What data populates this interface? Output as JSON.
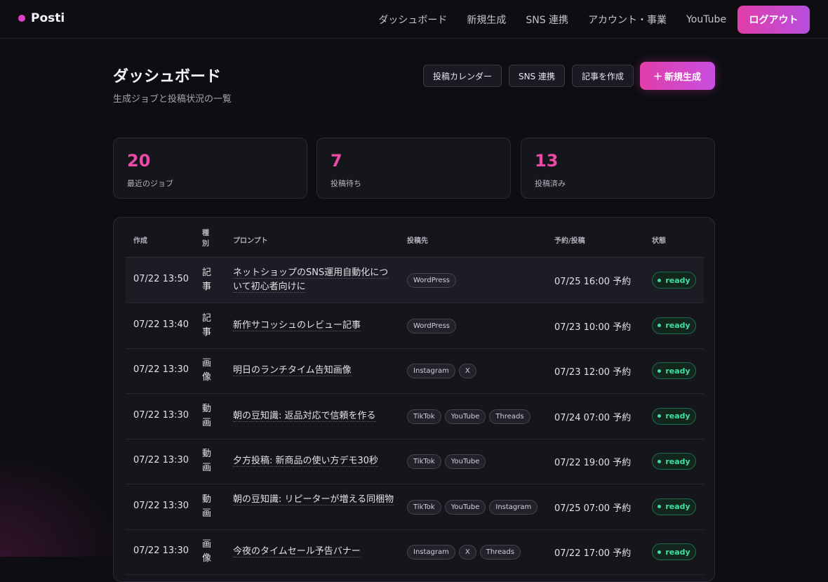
{
  "app": {
    "name": "Posti",
    "accent": "#e040c8",
    "success": "#3fe0a0"
  },
  "nav": {
    "links": [
      "ダッシュボード",
      "新規生成",
      "SNS 連携",
      "アカウント・事業",
      "YouTube"
    ],
    "logout": "ログアウト"
  },
  "header": {
    "title": "ダッシュボード",
    "subtitle": "生成ジョブと投稿状況の一覧",
    "actions": [
      "投稿カレンダー",
      "SNS 連携",
      "記事を作成"
    ],
    "primary_icon": "plus-icon",
    "primary": "新規生成"
  },
  "stats": [
    {
      "value": "20",
      "label": "最近のジョブ"
    },
    {
      "value": "7",
      "label": "投稿待ち"
    },
    {
      "value": "13",
      "label": "投稿済み"
    }
  ],
  "table": {
    "columns": {
      "created": "作成",
      "type": "種別",
      "prompt": "プロンプト",
      "targets": "投稿先",
      "schedule": "予約/投稿",
      "status": "状態"
    },
    "rows": [
      {
        "created": "07/22 13:50",
        "type": "記事",
        "prompt": "ネットショップのSNS運用自動化について初心者向けに",
        "targets": [
          "WordPress"
        ],
        "schedule": "07/25 16:00 予約",
        "status": "ready"
      },
      {
        "created": "07/22 13:40",
        "type": "記事",
        "prompt": "新作サコッシュのレビュー記事",
        "targets": [
          "WordPress"
        ],
        "schedule": "07/23 10:00 予約",
        "status": "ready"
      },
      {
        "created": "07/22 13:30",
        "type": "画像",
        "prompt": "明日のランチタイム告知画像",
        "targets": [
          "Instagram",
          "X"
        ],
        "schedule": "07/23 12:00 予約",
        "status": "ready"
      },
      {
        "created": "07/22 13:30",
        "type": "動画",
        "prompt": "朝の豆知識: 返品対応で信頼を作る",
        "targets": [
          "TikTok",
          "YouTube",
          "Threads"
        ],
        "schedule": "07/24 07:00 予約",
        "status": "ready"
      },
      {
        "created": "07/22 13:30",
        "type": "動画",
        "prompt": "夕方投稿: 新商品の使い方デモ30秒",
        "targets": [
          "TikTok",
          "YouTube"
        ],
        "schedule": "07/22 19:00 予約",
        "status": "ready"
      },
      {
        "created": "07/22 13:30",
        "type": "動画",
        "prompt": "朝の豆知識: リピーターが増える同梱物",
        "targets": [
          "TikTok",
          "YouTube",
          "Instagram"
        ],
        "schedule": "07/25 07:00 予約",
        "status": "ready"
      },
      {
        "created": "07/22 13:30",
        "type": "画像",
        "prompt": "今夜のタイムセール予告バナー",
        "targets": [
          "Instagram",
          "X",
          "Threads"
        ],
        "schedule": "07/22 17:00 予約",
        "status": "ready"
      }
    ]
  }
}
